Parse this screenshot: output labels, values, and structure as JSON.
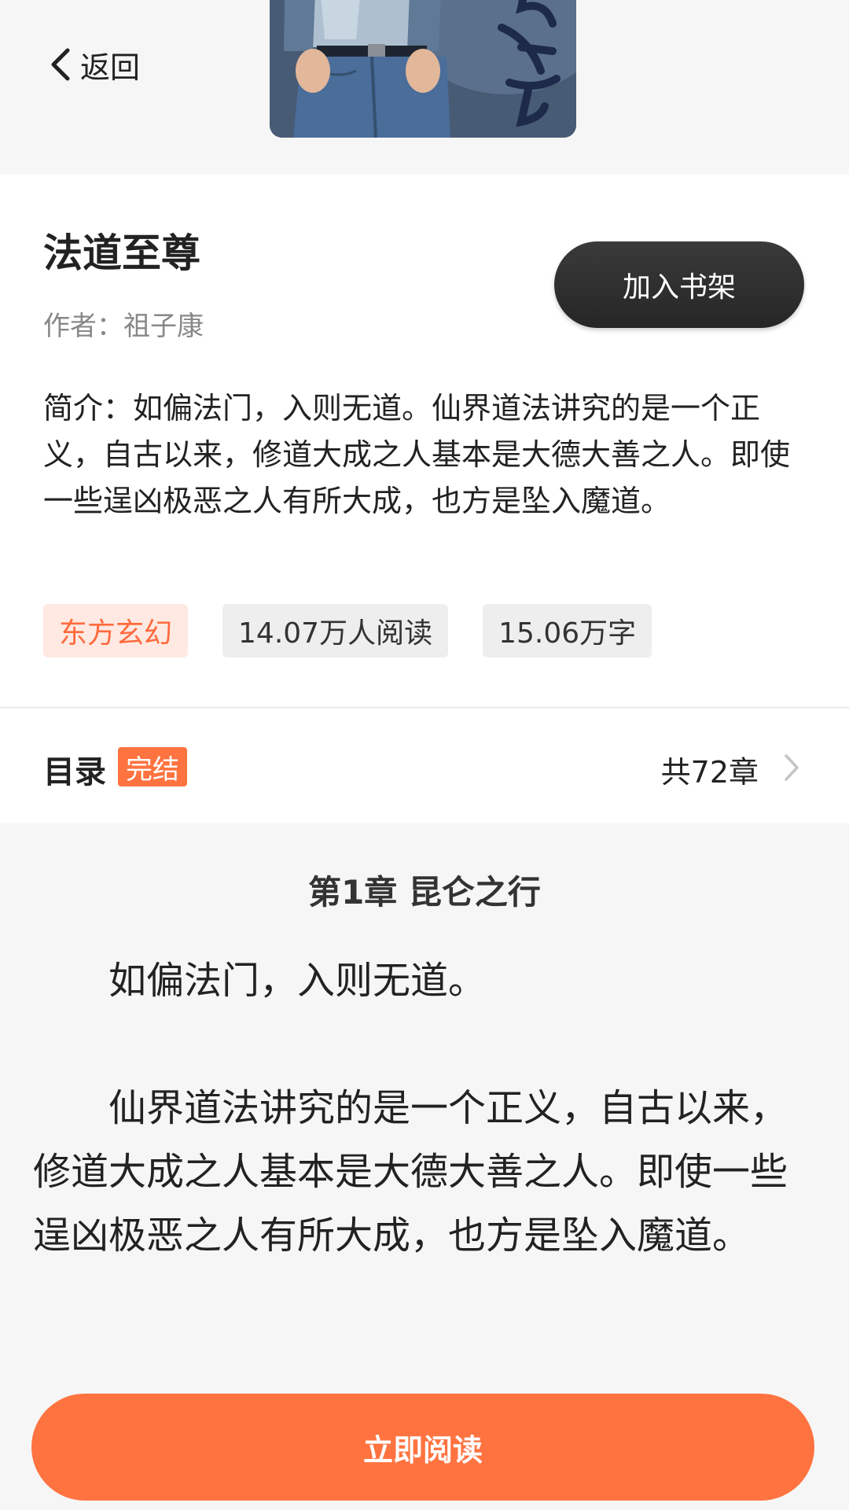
{
  "header": {
    "back_label": "返回"
  },
  "book": {
    "title": "法道至尊",
    "author": "作者：祖子康",
    "add_to_shelf_label": "加入书架",
    "intro": "简介：如偏法门，入则无道。仙界道法讲究的是一个正义，自古以来，修道大成之人基本是大德大善之人。即使一些逞凶极恶之人有所大成，也方是坠入魔道。",
    "tags": {
      "genre": "东方玄幻",
      "readers": "14.07万人阅读",
      "words": "15.06万字"
    }
  },
  "catalog": {
    "label": "目录",
    "status_badge": "完结",
    "chapter_count": "共72章"
  },
  "preview": {
    "chapter_title": "第1章 昆仑之行",
    "paragraph_1": "　　如偏法门，入则无道。",
    "paragraph_2": "　　仙界道法讲究的是一个正义，自古以来，修道大成之人基本是大德大善之人。即使一些逞凶极恶之人有所大成，也方是坠入魔道。"
  },
  "footer": {
    "read_now_label": "立即阅读"
  },
  "colors": {
    "accent": "#ff7340",
    "genre_tag_bg": "#ffe9e2",
    "genre_tag_text": "#ff6b3d",
    "shelf_button": "#2b2b2b",
    "background": "#f6f6f6"
  }
}
